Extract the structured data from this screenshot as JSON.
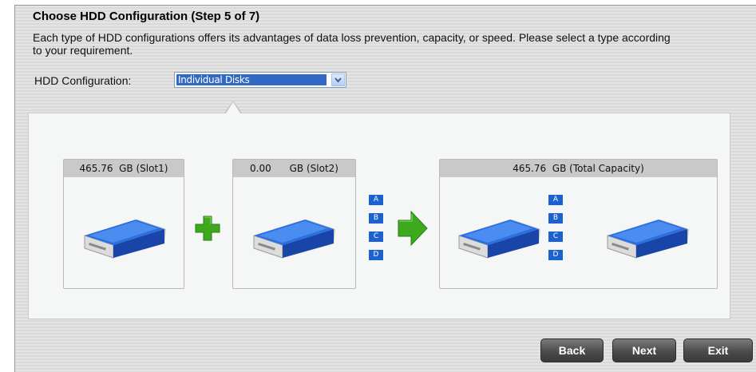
{
  "step": {
    "title": "Choose HDD Configuration (Step 5 of 7)",
    "description": "Each type of HDD configurations offers its advantages of data loss prevention, capacity, or speed. Please select a type according to your requirement."
  },
  "config": {
    "label": "HDD Configuration:",
    "selected": "Individual Disks"
  },
  "disks": {
    "slot1": "465.76  GB (Slot1)",
    "slot2": "0.00      GB (Slot2)",
    "total": "465.76  GB (Total Capacity)"
  },
  "slot_tags": [
    "A",
    "B",
    "C",
    "D"
  ],
  "colors": {
    "accent": "#1c62cf",
    "plus": "#3daa1e",
    "arrow": "#3daa1e",
    "button": "#4b4b4b"
  },
  "buttons": {
    "back": "Back",
    "next": "Next",
    "exit": "Exit"
  }
}
